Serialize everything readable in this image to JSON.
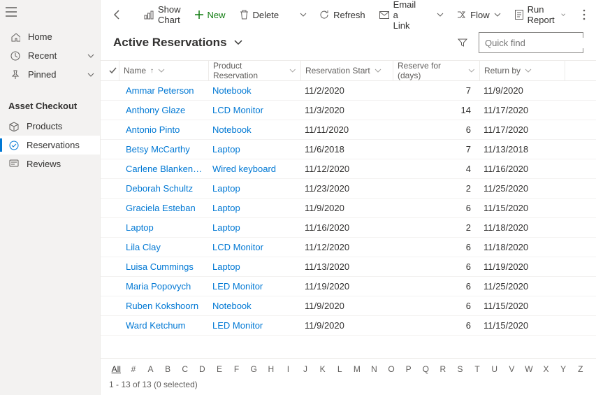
{
  "sidebar": {
    "nav": [
      {
        "icon": "home",
        "label": "Home"
      },
      {
        "icon": "clock",
        "label": "Recent",
        "expand": true
      },
      {
        "icon": "pin",
        "label": "Pinned",
        "expand": true
      }
    ],
    "section_title": "Asset Checkout",
    "subnav": [
      {
        "icon": "box",
        "label": "Products"
      },
      {
        "icon": "arrows",
        "label": "Reservations",
        "active": true
      },
      {
        "icon": "comment",
        "label": "Reviews"
      }
    ]
  },
  "commands": {
    "back": "Back",
    "show_chart": "Show Chart",
    "new": "New",
    "delete": "Delete",
    "refresh": "Refresh",
    "email": "Email a Link",
    "flow": "Flow",
    "run_report": "Run Report"
  },
  "view_title": "Active Reservations",
  "search_placeholder": "Quick find",
  "columns": {
    "name": "Name",
    "product": "Product Reservation",
    "start": "Reservation Start",
    "days": "Reserve for (days)",
    "return": "Return by"
  },
  "rows": [
    {
      "name": "Ammar Peterson",
      "product": "Notebook",
      "start": "11/2/2020",
      "days": "7",
      "ret": "11/9/2020"
    },
    {
      "name": "Anthony Glaze",
      "product": "LCD Monitor",
      "start": "11/3/2020",
      "days": "14",
      "ret": "11/17/2020"
    },
    {
      "name": "Antonio Pinto",
      "product": "Notebook",
      "start": "11/11/2020",
      "days": "6",
      "ret": "11/17/2020"
    },
    {
      "name": "Betsy McCarthy",
      "product": "Laptop",
      "start": "11/6/2018",
      "days": "7",
      "ret": "11/13/2018"
    },
    {
      "name": "Carlene Blankenship",
      "product": "Wired keyboard",
      "start": "11/12/2020",
      "days": "4",
      "ret": "11/16/2020"
    },
    {
      "name": "Deborah Schultz",
      "product": "Laptop",
      "start": "11/23/2020",
      "days": "2",
      "ret": "11/25/2020"
    },
    {
      "name": "Graciela Esteban",
      "product": "Laptop",
      "start": "11/9/2020",
      "days": "6",
      "ret": "11/15/2020"
    },
    {
      "name": "Laptop",
      "product": "Laptop",
      "start": "11/16/2020",
      "days": "2",
      "ret": "11/18/2020"
    },
    {
      "name": "Lila Clay",
      "product": "LCD Monitor",
      "start": "11/12/2020",
      "days": "6",
      "ret": "11/18/2020"
    },
    {
      "name": "Luisa Cummings",
      "product": "Laptop",
      "start": "11/13/2020",
      "days": "6",
      "ret": "11/19/2020"
    },
    {
      "name": "Maria Popovych",
      "product": "LED Monitor",
      "start": "11/19/2020",
      "days": "6",
      "ret": "11/25/2020"
    },
    {
      "name": "Ruben Kokshoorn",
      "product": "Notebook",
      "start": "11/9/2020",
      "days": "6",
      "ret": "11/15/2020"
    },
    {
      "name": "Ward Ketchum",
      "product": "LED Monitor",
      "start": "11/9/2020",
      "days": "6",
      "ret": "11/15/2020"
    }
  ],
  "az": {
    "all": "All",
    "items": [
      "#",
      "A",
      "B",
      "C",
      "D",
      "E",
      "F",
      "G",
      "H",
      "I",
      "J",
      "K",
      "L",
      "M",
      "N",
      "O",
      "P",
      "Q",
      "R",
      "S",
      "T",
      "U",
      "V",
      "W",
      "X",
      "Y",
      "Z"
    ]
  },
  "status": "1 - 13 of 13 (0 selected)"
}
